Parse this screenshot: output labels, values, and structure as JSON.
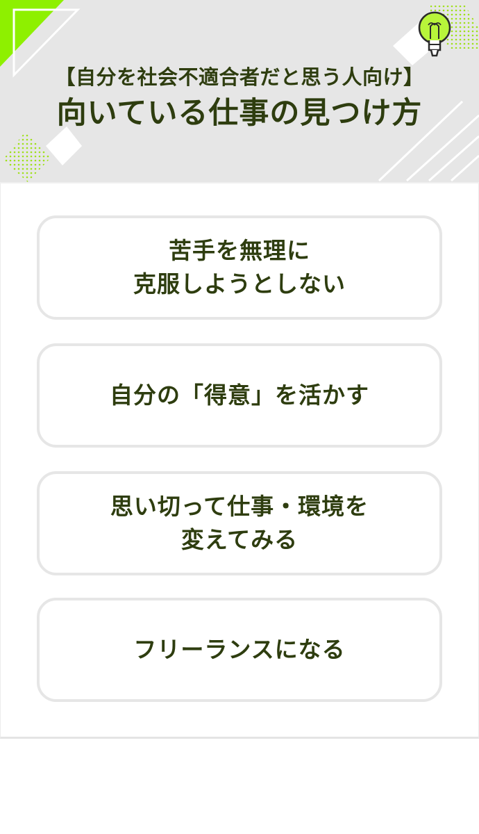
{
  "header": {
    "subtitle": "【自分を社会不適合者だと思う人向け】",
    "title": "向いている仕事の見つけ方",
    "lightbulb_icon": "lightbulb-icon",
    "accent_color": "#8ef000"
  },
  "items": [
    {
      "line1": "苦手を無理に",
      "line2": "克服しようとしない"
    },
    {
      "line1": "自分の「得意」を活かす"
    },
    {
      "line1": "思い切って仕事・環境を",
      "line2": "変えてみる"
    },
    {
      "line1": "フリーランスになる"
    }
  ]
}
